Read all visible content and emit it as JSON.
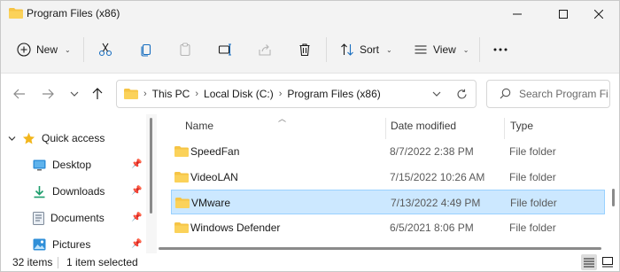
{
  "window": {
    "title": "Program Files (x86)"
  },
  "toolbar": {
    "new_label": "New",
    "sort_label": "Sort",
    "view_label": "View"
  },
  "address": {
    "crumbs": [
      "This PC",
      "Local Disk (C:)",
      "Program Files (x86)"
    ]
  },
  "search": {
    "placeholder": "Search Program Fi..."
  },
  "sidebar": {
    "items": [
      {
        "label": "Quick access",
        "icon": "star-icon"
      },
      {
        "label": "Desktop",
        "icon": "desktop-icon"
      },
      {
        "label": "Downloads",
        "icon": "download-icon"
      },
      {
        "label": "Documents",
        "icon": "documents-icon"
      },
      {
        "label": "Pictures",
        "icon": "pictures-icon"
      }
    ]
  },
  "columns": {
    "name": "Name",
    "date": "Date modified",
    "type": "Type"
  },
  "files": [
    {
      "name": "SpeedFan",
      "date": "8/7/2022 2:38 PM",
      "type": "File folder"
    },
    {
      "name": "VideoLAN",
      "date": "7/15/2022 10:26 AM",
      "type": "File folder"
    },
    {
      "name": "VMware",
      "date": "7/13/2022 4:49 PM",
      "type": "File folder"
    },
    {
      "name": "Windows Defender",
      "date": "6/5/2021 8:06 PM",
      "type": "File folder"
    }
  ],
  "status": {
    "items": "32 items",
    "selected": "1 item selected"
  },
  "colors": {
    "folder": "#f6c445",
    "selection_bg": "#cce8ff",
    "selection_border": "#99d1ff",
    "accent": "#0067c0"
  }
}
